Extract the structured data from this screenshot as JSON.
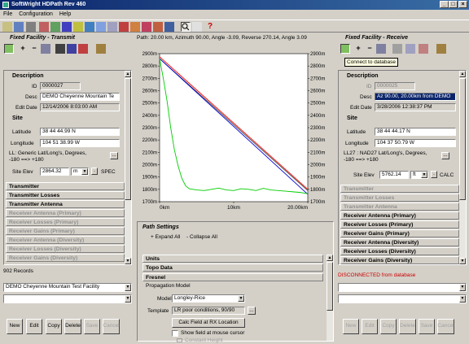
{
  "window": {
    "title": "SoftWright HDPath Rev 460"
  },
  "menu": [
    "File",
    "Configuration",
    "Help"
  ],
  "path_info": "Path: 20.00 km, Azimuth 90.00, Angle -3.09, Reverse 270.14, Angle 3.09",
  "left": {
    "title": "Fixed Facility - Transmit",
    "description_header": "Description",
    "id_label": "ID",
    "id_value": "0000027",
    "desc_label": "Desc",
    "desc_value": "DEMO Cheyenne Mountain Te",
    "edit_date_label": "Edit Date",
    "edit_date_value": "12/14/2006 8:03:00 AM",
    "site_header": "Site",
    "lat_label": "Latitude",
    "lat_value": "38 44 44.99 N",
    "lon_label": "Longitude",
    "lon_value": "104 51 38.99 W",
    "ll_text1": "LL: Generic Lat/Long's, Degrees,",
    "ll_text2": "-180 ==> +180",
    "elev_label": "Site Elev",
    "elev_value": "2864.32",
    "elev_unit": "m",
    "elev_extra": "SPEC",
    "sections": [
      {
        "label": "Transmitter",
        "enabled": true
      },
      {
        "label": "Transmitter Losses",
        "enabled": true
      },
      {
        "label": "Transmitter Antenna",
        "enabled": true
      },
      {
        "label": "Receiver Antenna (Primary)",
        "enabled": false
      },
      {
        "label": "Receiver Losses (Primary)",
        "enabled": false
      },
      {
        "label": "Receiver Gains (Primary)",
        "enabled": false
      },
      {
        "label": "Receiver Antenna (Diversity)",
        "enabled": false
      },
      {
        "label": "Receiver Losses (Diversity)",
        "enabled": false
      },
      {
        "label": "Receiver Gains (Diversity)",
        "enabled": false
      }
    ],
    "records": "902 Records",
    "combo_value": "DEMO Cheyenne Mountain Test Facility",
    "buttons": [
      {
        "label": "New",
        "enabled": true
      },
      {
        "label": "Edit",
        "enabled": true
      },
      {
        "label": "Copy",
        "enabled": true
      },
      {
        "label": "Delete",
        "enabled": true
      },
      {
        "label": "Save",
        "enabled": false
      },
      {
        "label": "Cancel",
        "enabled": false
      }
    ]
  },
  "right": {
    "title": "Fixed Facility - Receive",
    "tooltip": "Connect to database",
    "description_header": "Description",
    "id_label": "ID",
    "id_value": "0000025",
    "desc_label": "Desc",
    "desc_value": "Az 90.00, 20.00km from DEMO",
    "edit_date_label": "Edit Date",
    "edit_date_value": "3/28/2006 12:38:37 PM",
    "site_header": "Site",
    "lat_label": "Latitude",
    "lat_value": "38 44 44.17 N",
    "lon_label": "Longitude",
    "lon_value": "104 37 50.79 W",
    "ll_text1": "LL27 : NAD27 Lat/Long's, Degrees,",
    "ll_text2": "-180 ==> +180",
    "elev_label": "Site Elev",
    "elev_value": "5762.14",
    "elev_unit": "ft",
    "elev_extra": "CALC",
    "sections": [
      {
        "label": "Transmitter",
        "enabled": false
      },
      {
        "label": "Transmitter Losses",
        "enabled": false
      },
      {
        "label": "Transmitter Antenna",
        "enabled": false
      },
      {
        "label": "Receiver Antenna (Primary)",
        "enabled": true
      },
      {
        "label": "Receiver Losses (Primary)",
        "enabled": true
      },
      {
        "label": "Receiver Gains (Primary)",
        "enabled": true
      },
      {
        "label": "Receiver Antenna (Diversity)",
        "enabled": true
      },
      {
        "label": "Receiver Losses (Diversity)",
        "enabled": true
      },
      {
        "label": "Receiver Gains (Diversity)",
        "enabled": true
      }
    ],
    "status": "DISCONNECTED from database",
    "status_color": "#cc0000",
    "buttons": [
      {
        "label": "New",
        "enabled": false
      },
      {
        "label": "Edit",
        "enabled": false
      },
      {
        "label": "Copy",
        "enabled": false
      },
      {
        "label": "Delete",
        "enabled": false
      },
      {
        "label": "Save",
        "enabled": false
      },
      {
        "label": "Cancel",
        "enabled": false
      }
    ]
  },
  "chart_data": {
    "type": "line",
    "x_ticks": [
      "0km",
      "10km",
      "20.00km"
    ],
    "xlim": [
      0,
      20
    ],
    "ylim": [
      1700,
      2900
    ],
    "y_ticks": [
      "2900m",
      "2800m",
      "2700m",
      "2600m",
      "2500m",
      "2400m",
      "2300m",
      "2200m",
      "2100m",
      "2000m",
      "1900m",
      "1800m",
      "1700m"
    ],
    "y_right_ticks": [
      "2900m",
      "2800m",
      "2700m",
      "2600m",
      "2500m",
      "2400m",
      "2300m",
      "2200m",
      "2100m",
      "2000m",
      "1900m",
      "1800m",
      "1700m"
    ],
    "series": [
      {
        "color": "#ff0000",
        "x": [
          0,
          20
        ],
        "y": [
          2875,
          1800
        ]
      },
      {
        "color": "#404040",
        "x": [
          0,
          20
        ],
        "y": [
          2860,
          1790
        ]
      },
      {
        "color": "#0000cc",
        "x": [
          0,
          20
        ],
        "y": [
          2860,
          1760
        ]
      },
      {
        "color": "#00cc00",
        "x": [
          0,
          0.5,
          1,
          1.5,
          2,
          2.5,
          3,
          3.5,
          4,
          5,
          6,
          7,
          8,
          9,
          10,
          11,
          12,
          13,
          14,
          15,
          16,
          17,
          18,
          19,
          19.5,
          20
        ],
        "y": [
          2860,
          2700,
          2520,
          2300,
          2120,
          1990,
          1890,
          1830,
          1805,
          1795,
          1790,
          1800,
          1810,
          1795,
          1790,
          1805,
          1800,
          1790,
          1808,
          1795,
          1790,
          1785,
          1780,
          1775,
          1770,
          1765
        ]
      }
    ]
  },
  "settings": {
    "title": "Path Settings",
    "expand_all": "+ Expand All",
    "collapse_all": "- Collapse All",
    "sections": [
      "Units",
      "Topo Data",
      "Fresnel"
    ],
    "propagation_model_label": "Propagation Model",
    "model_label": "Model",
    "model_value": "Longley-Rice",
    "template_label": "Template",
    "template_value": "LR poor conditions, 90/90",
    "calc_button": "Calc Field at RX Location",
    "show_field_label": "Show field at mouse cursor",
    "constant_height_label": "Constant Height"
  }
}
